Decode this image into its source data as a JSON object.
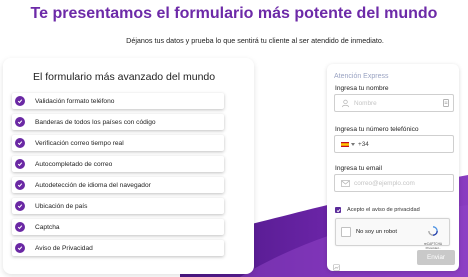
{
  "header": {
    "title": "Te presentamos el formulario más potente del mundo",
    "subtitle": "Déjanos tus datos y prueba lo que sentirá tu cliente al ser atendido de inmediato."
  },
  "features": {
    "title": "El formulario más avanzado del mundo",
    "items": [
      "Validación formato teléfono",
      "Banderas de todos los países con código",
      "Verificación correo tiempo real",
      "Autocompletado de correo",
      "Autodetección de idioma del navegador",
      "Ubicación de país",
      "Captcha",
      "Aviso de Privacidad"
    ]
  },
  "form": {
    "header": "Atención Express",
    "name_label": "Ingresa tu nombre",
    "name_placeholder": "Nombre",
    "phone_label": "Ingresa tu número telefónico",
    "phone_prefix": "+34",
    "email_label": "Ingresa tu email",
    "email_placeholder": "correo@ejemplo.com",
    "privacy_label": "Acepto el aviso de privacidad",
    "recaptcha_label": "No soy un robot",
    "recaptcha_brand": "reCAPTCHA",
    "recaptcha_links": "Privacidad - Términos",
    "submit_label": "Enviar"
  },
  "colors": {
    "accent": "#6d2aa8",
    "check": "#6a28a4",
    "wave_dark": "#4b1785",
    "wave_light": "#8c3fc2",
    "button_disabled": "#c9c9c9"
  }
}
